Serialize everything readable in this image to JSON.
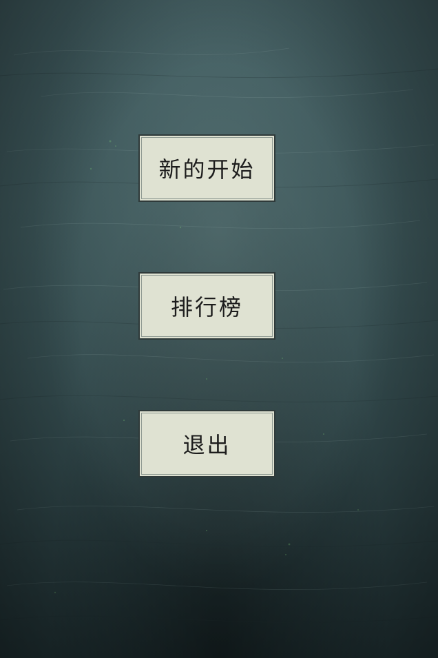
{
  "menu": {
    "new_game_label": "新的开始",
    "leaderboard_label": "排行榜",
    "exit_label": "退出"
  },
  "colors": {
    "background": "#3a5356",
    "button_face": "#dfe2d2",
    "button_text": "#1c1c1c"
  }
}
